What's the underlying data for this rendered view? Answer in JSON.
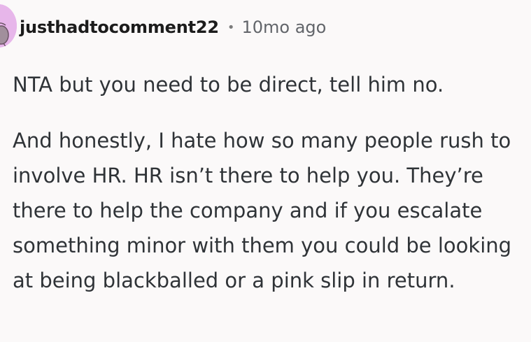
{
  "comment": {
    "username": "justhadtocomment22",
    "separator": "•",
    "timestamp": "10mo ago",
    "avatar_color": "#e7b6ea",
    "paragraphs": [
      "NTA but you need to be direct, tell him no.",
      "And honestly, I hate how so many people rush to involve HR. HR isn’t there to help you. They’re there to help the company and if you escalate something minor with them you could be looking at being blackballed or a pink slip in return."
    ]
  }
}
